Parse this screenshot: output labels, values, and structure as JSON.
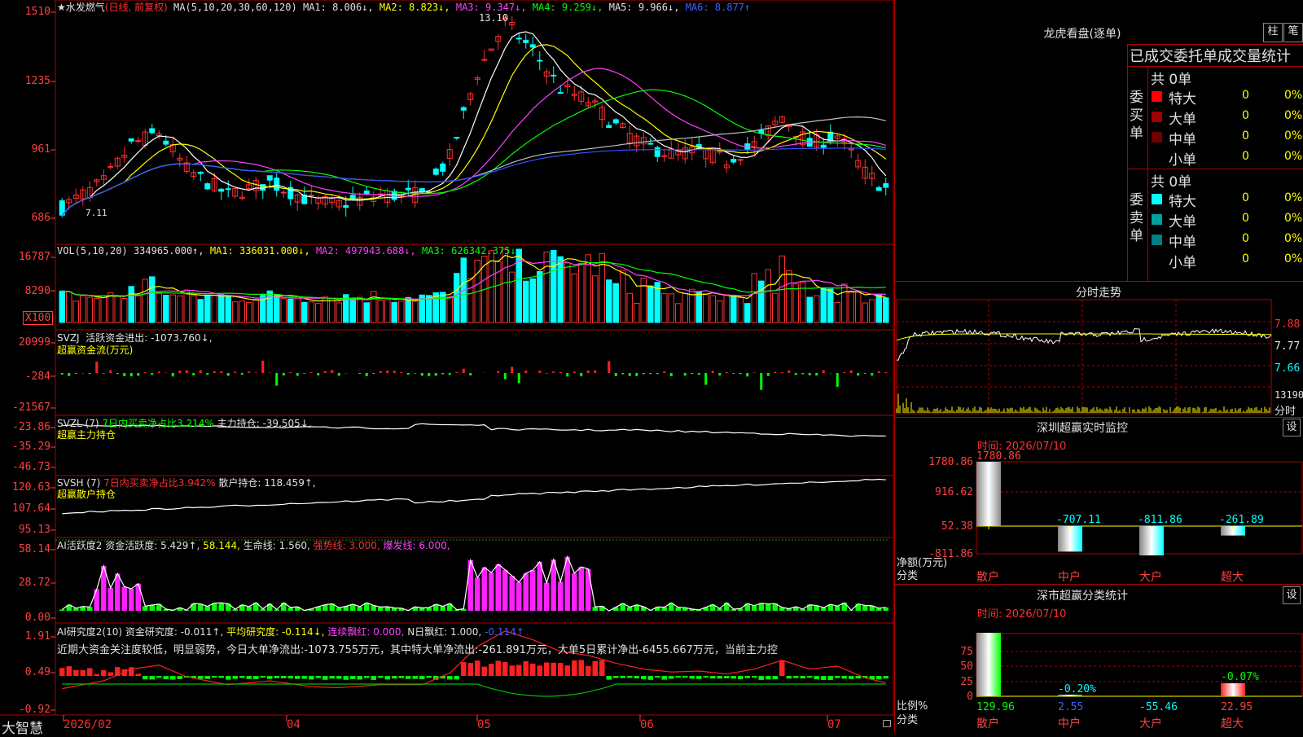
{
  "stock": {
    "name": "水发燃气",
    "period": "(日线, 前复权)",
    "star": "★"
  },
  "main_legend": {
    "ma_params": "MA(5,10,20,30,60,120)",
    "ma1": "MA1: 8.006↓,",
    "ma2": "MA2: 8.823↓,",
    "ma3": "MA3: 9.347↓,",
    "ma4": "MA4: 9.259↓,",
    "ma5": "MA5: 9.966↓,",
    "ma6": "MA6: 8.877↑"
  },
  "main_axis": [
    "1510",
    "1235",
    "961",
    "686"
  ],
  "price_marks": {
    "high": "13.10",
    "low": "7.11"
  },
  "vol_legend": {
    "label": "VOL(5,10,20)",
    "vol": "334965.000↑,",
    "ma1": "MA1: 336031.000↓,",
    "ma2": "MA2: 497943.688↓,",
    "ma3": "MA3: 626342.375↓"
  },
  "vol_axis": [
    "16787",
    "8290",
    "X100"
  ],
  "svzj_legend": {
    "label": "SVZJ",
    "active": "活跃资金进出: -1073.760↓,",
    "sub": "超赢资金流(万元)"
  },
  "svzj_axis": [
    "20999",
    "-284",
    "-21567"
  ],
  "svzl_legend": {
    "label": "SVZL (7)",
    "ratio": "7日内买卖净占比3.214%",
    "hold": "主力持仓: -39.505↓,",
    "sub": "超赢主力持仓"
  },
  "svzl_axis": [
    "-23.86",
    "-35.29",
    "-46.73"
  ],
  "svsh_legend": {
    "label": "SVSH (7)",
    "ratio": "7日内买卖净占比3.942%",
    "hold": "散户持仓: 118.459↑,",
    "sub": "超赢散户持仓"
  },
  "svsh_axis": [
    "120.63",
    "107.64",
    "95.13"
  ],
  "ai1_legend": {
    "label": "AI活跃度2",
    "act": "资金活跃度: 5.429↑,",
    "v2": "58.144,",
    "life": "生命线: 1.560,",
    "strong": "强势线: 3.000,",
    "burst": "爆发线: 6.000,"
  },
  "ai1_axis": [
    "58.14",
    "28.72",
    "0.00"
  ],
  "ai2_legend": {
    "label": "AI研究度2(10)",
    "study": "资金研究度: -0.011↑,",
    "avg": "平均研究度: -0.114↓,",
    "cont": "连续飘红: 0.000,",
    "nday": "N日飘红: 1.000,",
    "neg": "-0.114↑"
  },
  "ai2_text": "近期大资金关注度较低，明显弱势，今日大单净流出:-1073.755万元，其中特大单净流出:-261.891万元，大单5日累计净出-6455.667万元，当前主力控",
  "ai2_axis": [
    "1.91",
    "0.49",
    "-0.92"
  ],
  "x_axis": {
    "brand": "大智慧",
    "labels": [
      "2026/02",
      "04",
      "05",
      "06",
      "07"
    ]
  },
  "longhu": {
    "title": "龙虎看盘(逐单)",
    "btn1": "柱",
    "btn2": "笔",
    "header": "已成交委托单成交量统计",
    "buy_label": "委买单",
    "sell_label": "委卖单",
    "buy_total": "共 0单",
    "sell_total": "共 0单",
    "buy_rows": [
      {
        "name": "特大",
        "count": "0",
        "pct": "0%",
        "color": "#ff0000"
      },
      {
        "name": "大单",
        "count": "0",
        "pct": "0%",
        "color": "#a00000"
      },
      {
        "name": "中单",
        "count": "0",
        "pct": "0%",
        "color": "#700000"
      },
      {
        "name": "小单",
        "count": "0",
        "pct": "0%",
        "color": "#000000"
      }
    ],
    "sell_rows": [
      {
        "name": "特大",
        "count": "0",
        "pct": "0%",
        "color": "#00ffff"
      },
      {
        "name": "大单",
        "count": "0",
        "pct": "0%",
        "color": "#00a0a0"
      },
      {
        "name": "中单",
        "count": "0",
        "pct": "0%",
        "color": "#008080"
      },
      {
        "name": "小单",
        "count": "0",
        "pct": "0%",
        "color": "#000000"
      }
    ]
  },
  "intraday": {
    "title": "分时走势",
    "p1": "7.88",
    "p2": "7.77",
    "p3": "7.66",
    "vol": "13190",
    "unit": "分时"
  },
  "monitor": {
    "title": "深圳超赢实时监控",
    "btn": "设",
    "time": "时间: 2026/07/10",
    "axis": [
      "1780.86",
      "916.62",
      "52.38",
      "-811.86"
    ],
    "ylabel": "净额(万元)",
    "xlabel": "分类",
    "categories": [
      "散户",
      "中户",
      "大户",
      "超大"
    ],
    "labels": [
      "1780.86",
      "-707.11",
      "-811.86",
      "-261.89"
    ]
  },
  "classify": {
    "title": "深市超赢分类统计",
    "btn": "设",
    "time": "时间: 2026/07/10",
    "axis": [
      "75",
      "50",
      "25",
      "0"
    ],
    "ylabel": "比例%",
    "xlabel": "分类",
    "categories": [
      "散户",
      "中户",
      "大户",
      "超大"
    ],
    "top_labels": [
      "-0.20%",
      "-0.07%"
    ],
    "bottom_labels": [
      "129.96",
      "2.55",
      "-55.46",
      "22.95"
    ]
  },
  "chart_data": [
    {
      "type": "bar",
      "title": "深圳超赢实时监控",
      "categories": [
        "散户",
        "中户",
        "大户",
        "超大"
      ],
      "values": [
        1780.86,
        -707.11,
        -811.86,
        -261.89
      ],
      "ylabel": "净额(万元)",
      "ylim": [
        -811.86,
        1780.86
      ]
    },
    {
      "type": "bar",
      "title": "深市超赢分类统计",
      "categories": [
        "散户",
        "中户",
        "大户",
        "超大"
      ],
      "values": [
        129.96,
        2.55,
        -55.46,
        22.95
      ],
      "ylabel": "比例%"
    }
  ]
}
